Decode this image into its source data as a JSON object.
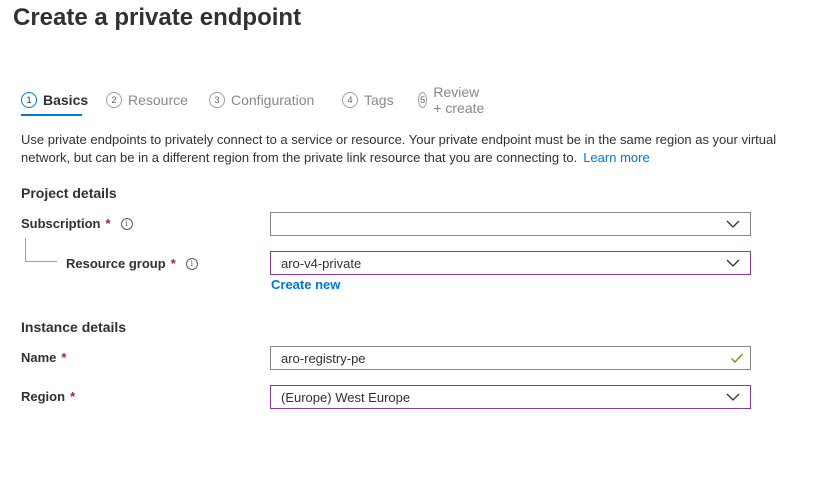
{
  "page": {
    "title": "Create a private endpoint"
  },
  "tabs": [
    {
      "num": "1",
      "label": "Basics",
      "active": true
    },
    {
      "num": "2",
      "label": "Resource",
      "active": false
    },
    {
      "num": "3",
      "label": "Configuration",
      "active": false
    },
    {
      "num": "4",
      "label": "Tags",
      "active": false
    },
    {
      "num": "5",
      "label": "Review + create",
      "active": false
    }
  ],
  "description": {
    "text": "Use private endpoints to privately connect to a service or resource. Your private endpoint must be in the same region as your virtual network, but can be in a different region from the private link resource that you are connecting to.",
    "learn_more": "Learn more"
  },
  "project": {
    "title": "Project details",
    "subscription": {
      "label": "Subscription",
      "required": "*",
      "info": "i",
      "value": ""
    },
    "resource_group": {
      "label": "Resource group",
      "required": "*",
      "info": "i",
      "value": "aro-v4-private",
      "create_new": "Create new"
    }
  },
  "instance": {
    "title": "Instance details",
    "name": {
      "label": "Name",
      "required": "*",
      "value": "aro-registry-pe"
    },
    "region": {
      "label": "Region",
      "required": "*",
      "value": "(Europe) West Europe"
    }
  },
  "colors": {
    "accent": "#0078d4",
    "required": "#a4262c",
    "focus_border": "#8a3a9b",
    "valid_check": "#57a300"
  },
  "icons": {
    "dropdown": "chevron-down-icon",
    "valid": "checkmark-icon",
    "info": "info-icon"
  }
}
